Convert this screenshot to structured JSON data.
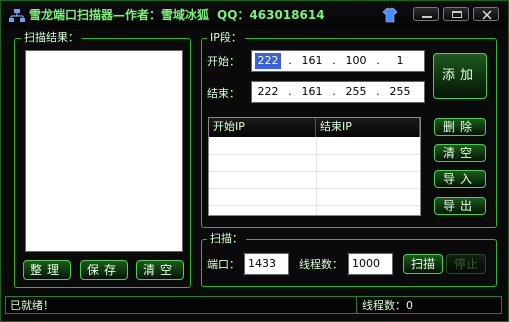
{
  "window": {
    "title": "雪龙端口扫描器—作者：雪域冰狐",
    "qq": "QQ：463018614"
  },
  "icons": {
    "app": "network-icon",
    "skin": "shirt-icon",
    "minimize": "minimize-icon",
    "maximize": "maximize-icon",
    "close": "close-icon"
  },
  "results": {
    "label": "扫描结果：",
    "buttons": {
      "sort": "整理",
      "save": "保存",
      "clear": "清空"
    }
  },
  "ip": {
    "label": "IP段：",
    "start_label": "开始：",
    "end_label": "结束：",
    "start": [
      "222",
      "161",
      "100",
      "1"
    ],
    "end": [
      "222",
      "161",
      "255",
      "255"
    ],
    "add": "添加",
    "table": {
      "headers": [
        "开始IP",
        "结束IP"
      ]
    },
    "buttons": {
      "delete": "删除",
      "clear": "清空",
      "import": "导入",
      "export": "导出"
    }
  },
  "scan": {
    "label": "扫描：",
    "port_label": "端口：",
    "port": "1433",
    "threads_label": "线程数：",
    "threads": "1000",
    "start": "扫描",
    "stop": "停止"
  },
  "status": {
    "left": "已就绪！",
    "right": "线程数：0"
  },
  "colors": {
    "accent": "#2fb52f",
    "title": "#7df07d",
    "background": "#0a0a0a"
  }
}
